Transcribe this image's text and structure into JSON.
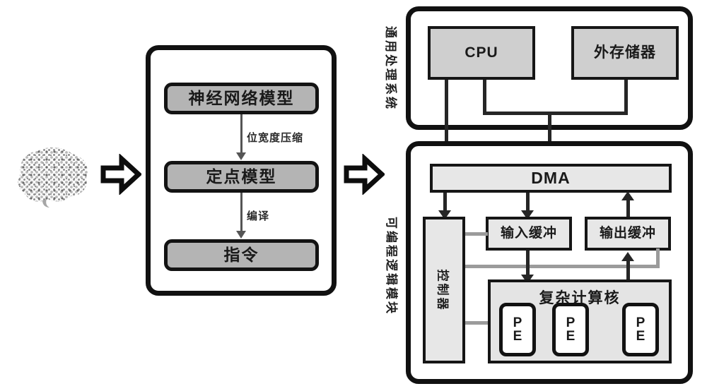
{
  "diagram": {
    "title": "Neural network model to FPGA accelerator deployment flow",
    "colors": {
      "stroke": "#111111",
      "stage_fill": "#b4b4b4",
      "hw_fill": "#cfcfcf",
      "lite_fill": "#e7e7e7",
      "core_fill": "#e4e4e4",
      "gray_wire": "#9b9b9b",
      "background": "#ffffff"
    }
  },
  "source": {
    "brain_icon": "stippled-brain-icon",
    "arrow1": "block-arrow-right-icon",
    "arrow2": "block-arrow-right-icon"
  },
  "toolchain": {
    "panel_name": "software-toolchain-panel",
    "stages": [
      {
        "label": "神经网络模型",
        "name": "stage-neural-network-model"
      },
      {
        "label": "定点模型",
        "name": "stage-fixed-point-model"
      },
      {
        "label": "指令",
        "name": "stage-instruction"
      }
    ],
    "transitions": [
      {
        "label": "位宽度压缩",
        "name": "transition-bitwidth-compression"
      },
      {
        "label": "编译",
        "name": "transition-compile"
      }
    ]
  },
  "host": {
    "side_label": "通用处理系统",
    "blocks": [
      {
        "label": "CPU",
        "name": "block-cpu"
      },
      {
        "label": "外存储器",
        "name": "block-external-memory"
      }
    ]
  },
  "fpga": {
    "side_label": "可编程逻辑模块",
    "dma": {
      "label": "DMA",
      "name": "block-dma"
    },
    "controller": {
      "label": "控制器",
      "name": "block-controller"
    },
    "input_buffer": {
      "label": "输入缓冲",
      "name": "block-input-buffer"
    },
    "output_buffer": {
      "label": "输出缓冲",
      "name": "block-output-buffer"
    },
    "compute_core": {
      "label": "复杂计算核",
      "name": "block-complex-compute-core"
    },
    "pes": [
      {
        "line1": "P",
        "line2": "E",
        "name": "block-pe-1"
      },
      {
        "line1": "P",
        "line2": "E",
        "name": "block-pe-2"
      },
      {
        "line1": "P",
        "line2": "E",
        "name": "block-pe-3"
      }
    ]
  }
}
